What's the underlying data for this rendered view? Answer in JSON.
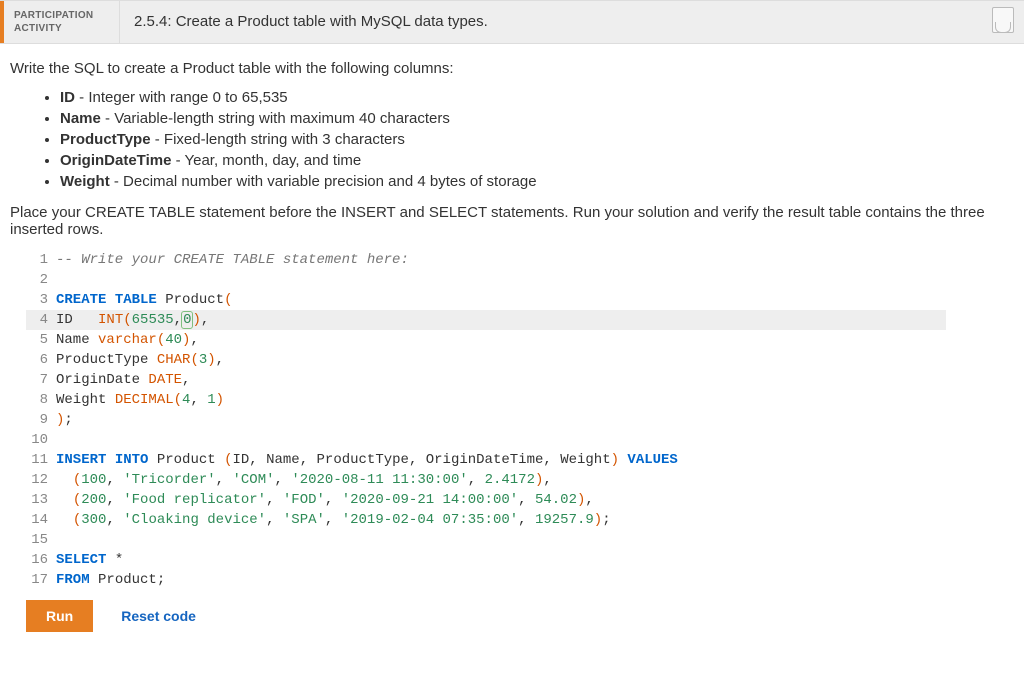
{
  "header": {
    "tag_line1": "PARTICIPATION",
    "tag_line2": "ACTIVITY",
    "title": "2.5.4: Create a Product table with MySQL data types."
  },
  "prompt": {
    "intro": "Write the SQL to create a Product table with the following columns:",
    "columns": [
      {
        "name": "ID",
        "desc": " - Integer with range 0 to 65,535"
      },
      {
        "name": "Name",
        "desc": " - Variable-length string with maximum 40 characters"
      },
      {
        "name": "ProductType",
        "desc": " - Fixed-length string with 3 characters"
      },
      {
        "name": "OriginDateTime",
        "desc": " - Year, month, day, and time"
      },
      {
        "name": "Weight",
        "desc": " - Decimal number with variable precision and 4 bytes of storage"
      }
    ],
    "outro": "Place your CREATE TABLE statement before the INSERT and SELECT statements. Run your solution and verify the result table contains the three inserted rows."
  },
  "code": {
    "current_line": 4,
    "tokens": [
      [
        {
          "t": "-- Write your CREATE TABLE statement here:",
          "c": "comment"
        }
      ],
      [],
      [
        {
          "t": "CREATE",
          "c": "kw"
        },
        {
          "t": " "
        },
        {
          "t": "TABLE",
          "c": "kw"
        },
        {
          "t": " Product",
          "c": "ident"
        },
        {
          "t": "(",
          "c": "paren"
        }
      ],
      [
        {
          "t": "ID   ",
          "c": "ident"
        },
        {
          "t": "INT",
          "c": "type"
        },
        {
          "t": "(",
          "c": "paren"
        },
        {
          "t": "65535",
          "c": "num"
        },
        {
          "t": ",",
          "c": "punct"
        },
        {
          "t": "0",
          "c": "num",
          "cursor": true
        },
        {
          "t": ")",
          "c": "paren"
        },
        {
          "t": ",",
          "c": "punct"
        }
      ],
      [
        {
          "t": "Name ",
          "c": "ident"
        },
        {
          "t": "varchar",
          "c": "type"
        },
        {
          "t": "(",
          "c": "paren"
        },
        {
          "t": "40",
          "c": "num"
        },
        {
          "t": ")",
          "c": "paren"
        },
        {
          "t": ",",
          "c": "punct"
        }
      ],
      [
        {
          "t": "ProductType ",
          "c": "ident"
        },
        {
          "t": "CHAR",
          "c": "type"
        },
        {
          "t": "(",
          "c": "paren"
        },
        {
          "t": "3",
          "c": "num"
        },
        {
          "t": ")",
          "c": "paren"
        },
        {
          "t": ",",
          "c": "punct"
        }
      ],
      [
        {
          "t": "OriginDate ",
          "c": "ident"
        },
        {
          "t": "DATE",
          "c": "type"
        },
        {
          "t": ",",
          "c": "punct"
        }
      ],
      [
        {
          "t": "Weight ",
          "c": "ident"
        },
        {
          "t": "DECIMAL",
          "c": "type"
        },
        {
          "t": "(",
          "c": "paren"
        },
        {
          "t": "4",
          "c": "num"
        },
        {
          "t": ", ",
          "c": "punct"
        },
        {
          "t": "1",
          "c": "num"
        },
        {
          "t": ")",
          "c": "paren"
        }
      ],
      [
        {
          "t": ")",
          "c": "paren"
        },
        {
          "t": ";",
          "c": "punct"
        }
      ],
      [],
      [
        {
          "t": "INSERT",
          "c": "kw"
        },
        {
          "t": " "
        },
        {
          "t": "INTO",
          "c": "kw"
        },
        {
          "t": " Product ",
          "c": "ident"
        },
        {
          "t": "(",
          "c": "paren"
        },
        {
          "t": "ID",
          "c": "ident"
        },
        {
          "t": ", ",
          "c": "punct"
        },
        {
          "t": "Name",
          "c": "ident"
        },
        {
          "t": ", ",
          "c": "punct"
        },
        {
          "t": "ProductType",
          "c": "ident"
        },
        {
          "t": ", ",
          "c": "punct"
        },
        {
          "t": "OriginDateTime",
          "c": "ident"
        },
        {
          "t": ", ",
          "c": "punct"
        },
        {
          "t": "Weight",
          "c": "ident"
        },
        {
          "t": ")",
          "c": "paren"
        },
        {
          "t": " "
        },
        {
          "t": "VALUES",
          "c": "kw"
        }
      ],
      [
        {
          "t": "  "
        },
        {
          "t": "(",
          "c": "paren"
        },
        {
          "t": "100",
          "c": "num"
        },
        {
          "t": ", ",
          "c": "punct"
        },
        {
          "t": "'Tricorder'",
          "c": "str"
        },
        {
          "t": ", ",
          "c": "punct"
        },
        {
          "t": "'COM'",
          "c": "str"
        },
        {
          "t": ", ",
          "c": "punct"
        },
        {
          "t": "'2020-08-11 11:30:00'",
          "c": "str"
        },
        {
          "t": ", ",
          "c": "punct"
        },
        {
          "t": "2.4172",
          "c": "num"
        },
        {
          "t": ")",
          "c": "paren"
        },
        {
          "t": ",",
          "c": "punct"
        }
      ],
      [
        {
          "t": "  "
        },
        {
          "t": "(",
          "c": "paren"
        },
        {
          "t": "200",
          "c": "num"
        },
        {
          "t": ", ",
          "c": "punct"
        },
        {
          "t": "'Food replicator'",
          "c": "str"
        },
        {
          "t": ", ",
          "c": "punct"
        },
        {
          "t": "'FOD'",
          "c": "str"
        },
        {
          "t": ", ",
          "c": "punct"
        },
        {
          "t": "'2020-09-21 14:00:00'",
          "c": "str"
        },
        {
          "t": ", ",
          "c": "punct"
        },
        {
          "t": "54.02",
          "c": "num"
        },
        {
          "t": ")",
          "c": "paren"
        },
        {
          "t": ",",
          "c": "punct"
        }
      ],
      [
        {
          "t": "  "
        },
        {
          "t": "(",
          "c": "paren"
        },
        {
          "t": "300",
          "c": "num"
        },
        {
          "t": ", ",
          "c": "punct"
        },
        {
          "t": "'Cloaking device'",
          "c": "str"
        },
        {
          "t": ", ",
          "c": "punct"
        },
        {
          "t": "'SPA'",
          "c": "str"
        },
        {
          "t": ", ",
          "c": "punct"
        },
        {
          "t": "'2019-02-04 07:35:00'",
          "c": "str"
        },
        {
          "t": ", ",
          "c": "punct"
        },
        {
          "t": "19257.9",
          "c": "num"
        },
        {
          "t": ")",
          "c": "paren"
        },
        {
          "t": ";",
          "c": "punct"
        }
      ],
      [],
      [
        {
          "t": "SELECT",
          "c": "kw"
        },
        {
          "t": " *",
          "c": "punct"
        }
      ],
      [
        {
          "t": "FROM",
          "c": "kw"
        },
        {
          "t": " Product",
          "c": "ident"
        },
        {
          "t": ";",
          "c": "punct"
        }
      ]
    ]
  },
  "buttons": {
    "run": "Run",
    "reset": "Reset code"
  }
}
